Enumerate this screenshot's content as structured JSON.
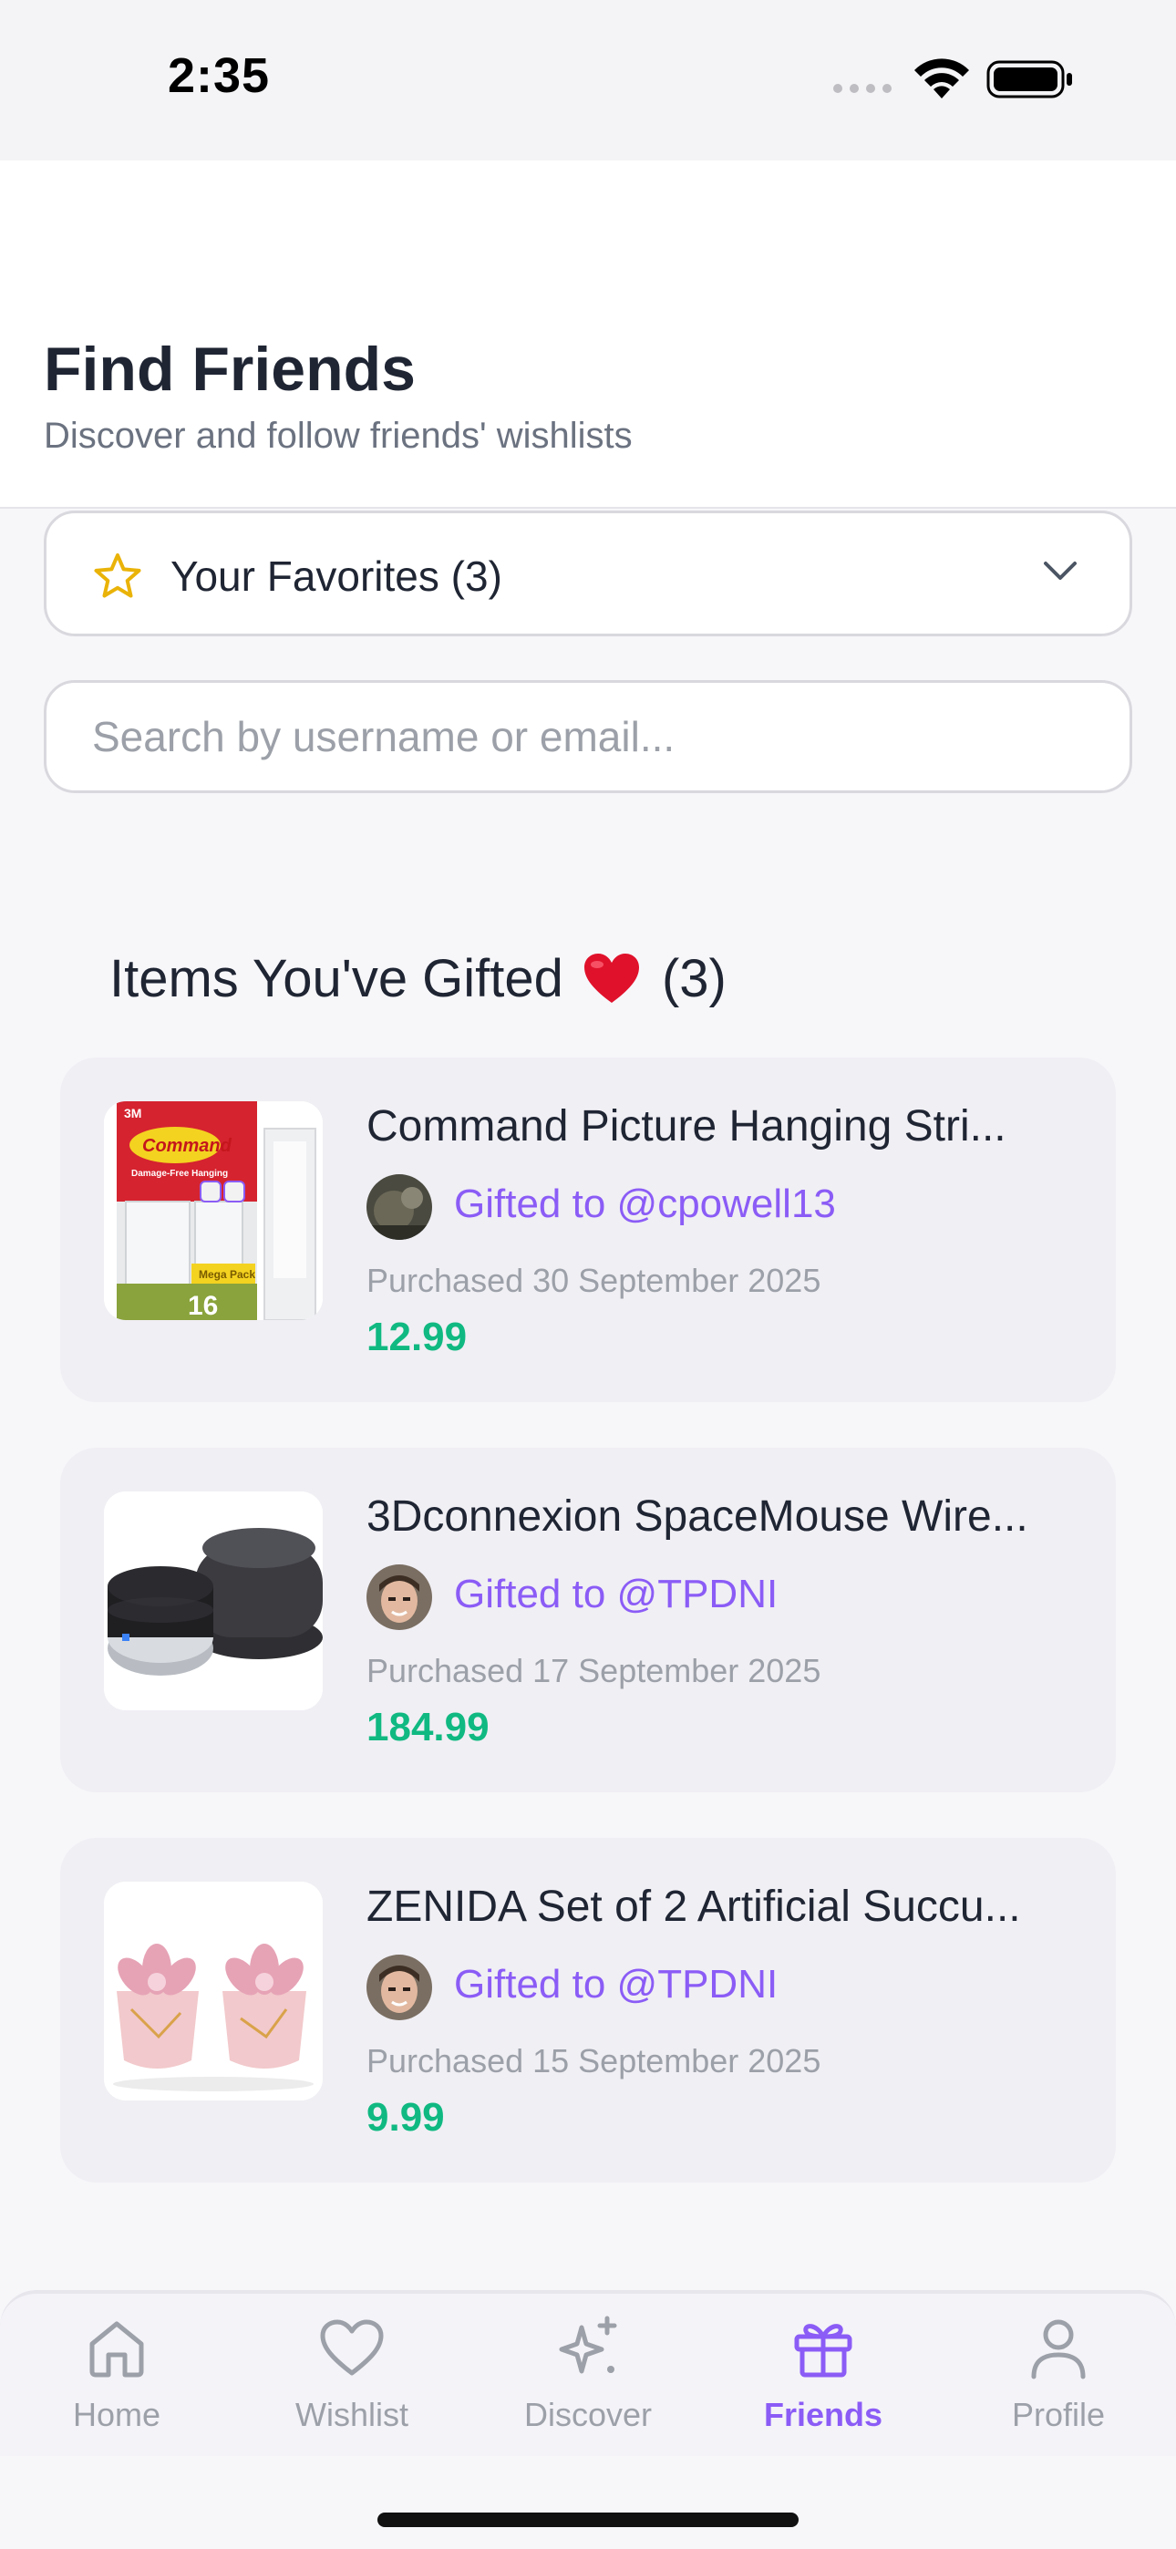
{
  "status_bar": {
    "time": "2:35"
  },
  "header": {
    "title": "Find Friends",
    "subtitle": "Discover and follow friends' wishlists"
  },
  "favorites": {
    "label": "Your Favorites (3)"
  },
  "search": {
    "placeholder": "Search by username or email..."
  },
  "gifted_section": {
    "title": "Items You've Gifted",
    "count": "(3)"
  },
  "gifted_items": [
    {
      "name": "Command Picture Hanging Stri...",
      "gifted_to": "Gifted to @cpowell13",
      "purchased": "Purchased 30 September 2025",
      "price": "12.99",
      "image_text": {
        "brand": "3M",
        "product": "Command",
        "tagline": "Damage-Free Hanging",
        "pack": "Mega Pack",
        "count": "16"
      }
    },
    {
      "name": "3Dconnexion SpaceMouse Wire...",
      "gifted_to": "Gifted to @TPDNI",
      "purchased": "Purchased 17 September 2025",
      "price": "184.99"
    },
    {
      "name": "ZENIDA Set of 2 Artificial Succu...",
      "gifted_to": "Gifted to @TPDNI",
      "purchased": "Purchased 15 September 2025",
      "price": "9.99"
    }
  ],
  "tabbar": {
    "tabs": [
      {
        "label": "Home",
        "icon": "home-icon"
      },
      {
        "label": "Wishlist",
        "icon": "heart-icon"
      },
      {
        "label": "Discover",
        "icon": "sparkles-icon"
      },
      {
        "label": "Friends",
        "icon": "gift-icon",
        "active": true
      },
      {
        "label": "Profile",
        "icon": "person-icon"
      }
    ]
  },
  "colors": {
    "accent": "#8b5cf6",
    "price": "#10b981",
    "star": "#eab308",
    "heart": "#e0112b"
  }
}
